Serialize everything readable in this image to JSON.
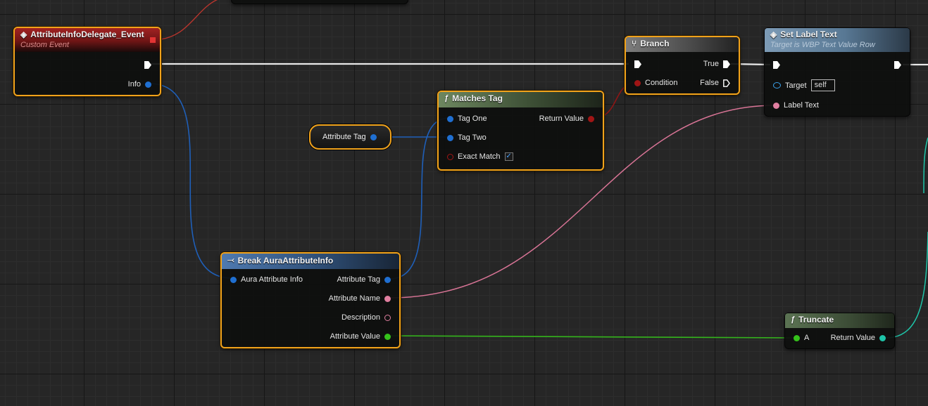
{
  "nodes": {
    "event": {
      "title": "AttributeInfoDelegate_Event",
      "subtitle": "Custom Event",
      "out_info": "Info"
    },
    "attribute_tag_var": {
      "label": "Attribute Tag"
    },
    "matches_tag": {
      "title": "Matches Tag",
      "tag_one": "Tag One",
      "tag_two": "Tag Two",
      "exact_match": "Exact Match",
      "return_value": "Return Value",
      "exact_match_checked": "✓"
    },
    "branch": {
      "title": "Branch",
      "condition": "Condition",
      "true_label": "True",
      "false_label": "False"
    },
    "set_label_text": {
      "title": "Set Label Text",
      "subtitle": "Target is WBP Text Value Row",
      "target": "Target",
      "target_value": "self",
      "label_text": "Label Text"
    },
    "break_struct": {
      "title": "Break AuraAttributeInfo",
      "in_info": "Aura Attribute Info",
      "attribute_tag": "Attribute Tag",
      "attribute_name": "Attribute Name",
      "description": "Description",
      "attribute_value": "Attribute Value"
    },
    "truncate": {
      "title": "Truncate",
      "a": "A",
      "return_value": "Return Value"
    }
  },
  "icons": {
    "event": "diamond-arrow-icon",
    "function": "function-f-icon",
    "branch": "branch-icon",
    "break": "break-struct-icon"
  },
  "colors": {
    "exec": "#ffffff",
    "struct": "#1f6fd1",
    "bool": "#a01515",
    "text": "#e07fa0",
    "float": "#35c21b",
    "string": "#1ec4a8",
    "selection": "#f0a21b"
  }
}
